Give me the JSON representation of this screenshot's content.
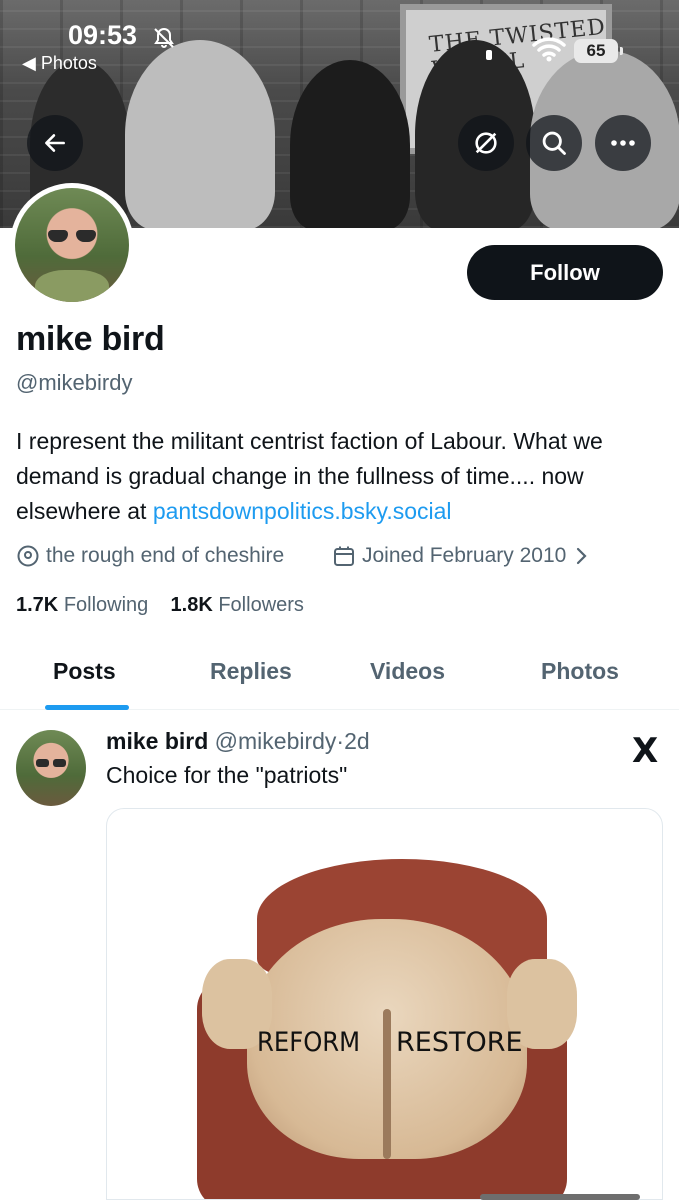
{
  "status_bar": {
    "time": "09:53",
    "back_app": "◀ Photos",
    "battery": "65"
  },
  "banner": {
    "sign_text": "THE TWISTED WHEEL"
  },
  "profile": {
    "display_name": "mike bird",
    "handle": "@mikebirdy",
    "follow_label": "Follow",
    "bio_text": "I represent the militant centrist faction of Labour. What we demand is gradual change in the fullness of time.... now elsewhere at ",
    "bio_link": "pantsdownpolitics.bsky.social",
    "location": "the rough end of cheshire",
    "joined": "Joined February 2010",
    "following_count": "1.7K",
    "following_label": "Following",
    "followers_count": "1.8K",
    "followers_label": "Followers"
  },
  "tabs": [
    {
      "label": "Posts",
      "active": true
    },
    {
      "label": "Replies",
      "active": false
    },
    {
      "label": "Videos",
      "active": false
    },
    {
      "label": "Photos",
      "active": false
    }
  ],
  "post": {
    "author_name": "mike bird",
    "author_handle": "@mikebirdy",
    "separator": "·",
    "age": "2d",
    "text": "Choice for the \"patriots\"",
    "x_logo": "X",
    "image_labels": {
      "left": "REFORM",
      "right": "RESTORE"
    }
  },
  "icons": {
    "back": "back-arrow-icon",
    "grok": "grok-icon",
    "search": "search-icon",
    "more": "more-icon",
    "location": "location-pin-icon",
    "calendar": "calendar-icon",
    "chevron": "chevron-right-icon"
  },
  "colors": {
    "accent": "#1d9bf0",
    "text_primary": "#0f1419",
    "text_secondary": "#536471",
    "follow_bg": "#0f1419"
  }
}
